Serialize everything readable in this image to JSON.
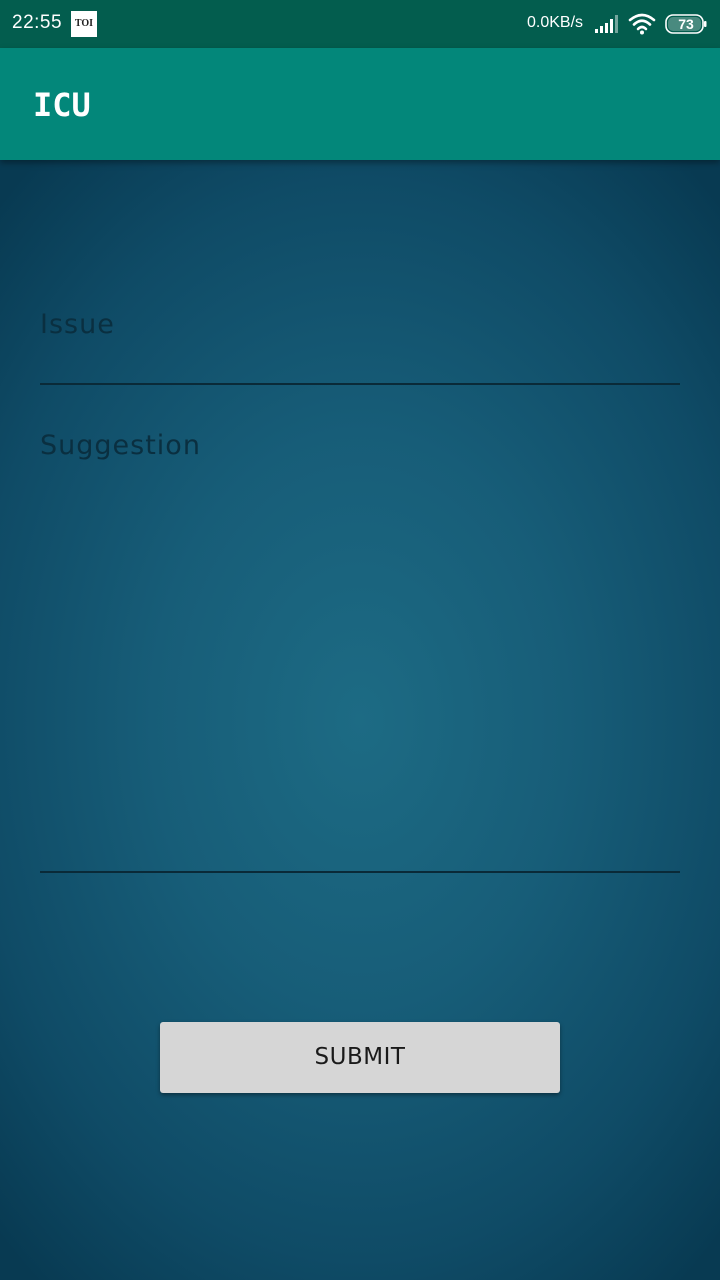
{
  "status_bar": {
    "time": "22:55",
    "notification_badge": "TOI",
    "network_speed": "0.0KB/s",
    "battery_level": "73",
    "icons": [
      "signal-icon",
      "wifi-icon",
      "battery-icon"
    ]
  },
  "app_bar": {
    "title": "ICU",
    "color": "#03877a"
  },
  "form": {
    "issue_placeholder": "Issue",
    "suggestion_placeholder": "Suggestion",
    "submit_label": "SUBMIT"
  },
  "colors": {
    "status_bar": "#035d4e",
    "app_bar": "#03877a",
    "background": "#175d78",
    "button": "#d6d6d6"
  }
}
